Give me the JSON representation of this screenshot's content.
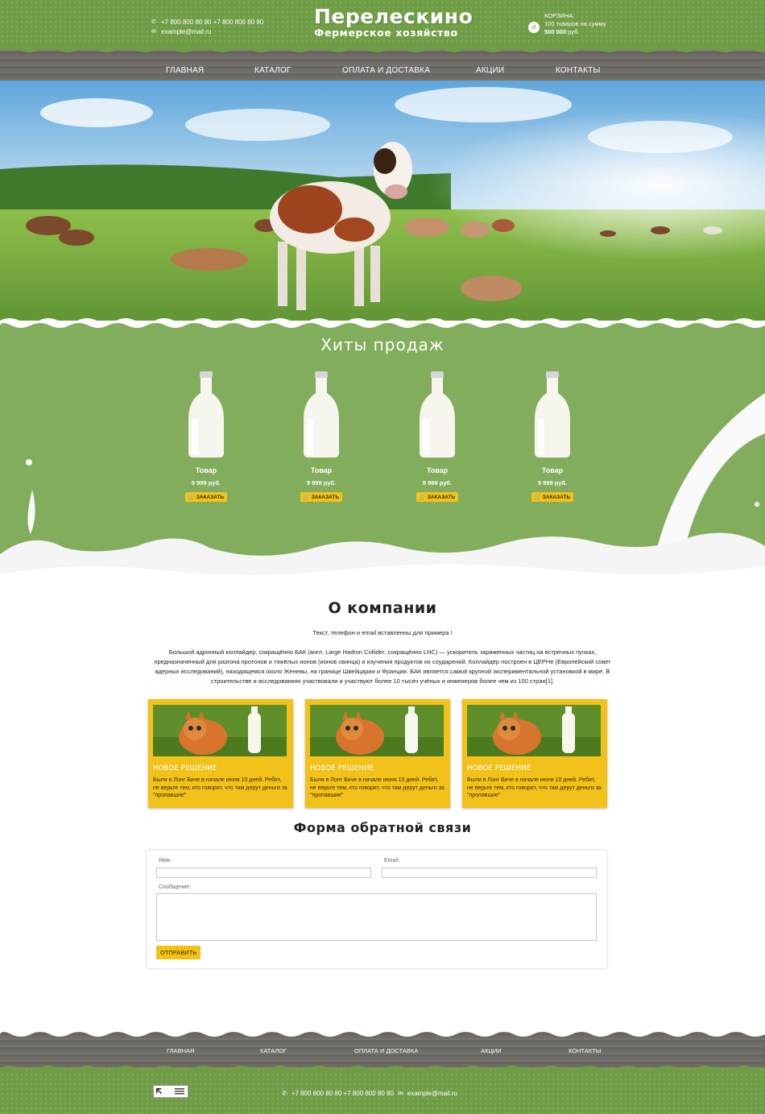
{
  "header": {
    "phone_icon": "phone-icon",
    "phones": "+7 800 800 80 80  +7 800 800 80 80",
    "mail_icon": "mail-icon",
    "email": "example@mail.ru",
    "logo_title": "Перелескино",
    "logo_subtitle": "Фермерское хозяйство",
    "cart_label": "КОРЗИНА:",
    "cart_text": "100 товаров на сумму",
    "cart_sum": "500 000",
    "cart_currency": "руб.",
    "cart_icon": "basket-icon"
  },
  "nav": [
    {
      "label": "ГЛАВНАЯ"
    },
    {
      "label": "КАТАЛОГ"
    },
    {
      "label": "ОПЛАТА И ДОСТАВКА"
    },
    {
      "label": "АКЦИИ"
    },
    {
      "label": "КОНТАКТЫ"
    }
  ],
  "hits": {
    "title": "Хиты продаж",
    "products": [
      {
        "name": "Товар",
        "price": "9 999 руб.",
        "button": "ЗАКАЗАТЬ"
      },
      {
        "name": "Товар",
        "price": "9 999 руб.",
        "button": "ЗАКАЗАТЬ"
      },
      {
        "name": "Товар",
        "price": "9 999 руб.",
        "button": "ЗАКАЗАТЬ"
      },
      {
        "name": "Товар",
        "price": "9 999 руб.",
        "button": "ЗАКАЗАТЬ"
      }
    ],
    "button_icon": "cart-icon"
  },
  "about": {
    "title": "О компании",
    "note": "Текст, телефон и email вставленны для примера !",
    "text": "Большой адронный коллайдер, сокращённо БАК (англ. Large Hadron Collider, сокращённо LHC) — ускоритель заряженных частиц на встречных пучках, предназначенный для разгона протонов и тяжёлых ионов (ионов свинца) и изучения продуктов их соударений. Коллайдер построен в ЦЕРНе (Европейский совет ядерных исследований), находящемся около Женевы, на границе Швейцарии и Франции. БАК является самой крупной экспериментальной установкой в мире. В строительстве и исследованиях участвовали и участвуют более 10 тысяч учёных и инженеров более чем из 100 стран[1]."
  },
  "cards": [
    {
      "title": "НОВОЕ РЕШЕНИЕ",
      "text": "Были в Лонг Биче в начале июня 10 дней. Ребят, не верьте тем, кто говорит, что там дерут деньги за \"пропавшие\""
    },
    {
      "title": "НОВОЕ РЕШЕНИЕ",
      "text": "Были в Лонг Биче в начале июня 10 дней. Ребят, не верьте тем, кто говорит, что там дерут деньги за \"пропавшие\""
    },
    {
      "title": "НОВОЕ РЕШЕНИЕ",
      "text": "Были в Лонг Биче в начале июня 10 дней. Ребят, не верьте тем, кто говорит, что там дерут деньги за \"пропавшие\""
    }
  ],
  "form": {
    "title": "Форма обратной связи",
    "name_label": "Имя:",
    "email_label": "Email:",
    "message_label": "Сообщение:",
    "name_value": "",
    "email_value": "",
    "message_value": "",
    "submit": "ОТПРАВИТЬ"
  },
  "footer": {
    "nav": [
      {
        "label": "ГЛАВНАЯ"
      },
      {
        "label": "КАТАЛОГ"
      },
      {
        "label": "ОПЛАТА И ДОСТАВКА"
      },
      {
        "label": "АКЦИИ"
      },
      {
        "label": "КОНТАКТЫ"
      }
    ],
    "phone_icon": "phone-icon",
    "phones": "+7 800 800 80 80  +7 800 800 80 80",
    "mail_icon": "mail-icon",
    "email": "example@mail.ru",
    "counter_icon": "counter-badge-icon"
  },
  "colors": {
    "green": "#6f9d45",
    "light_green": "#82ad5c",
    "yellow": "#f2c21a",
    "wood": "#6f6b66"
  }
}
